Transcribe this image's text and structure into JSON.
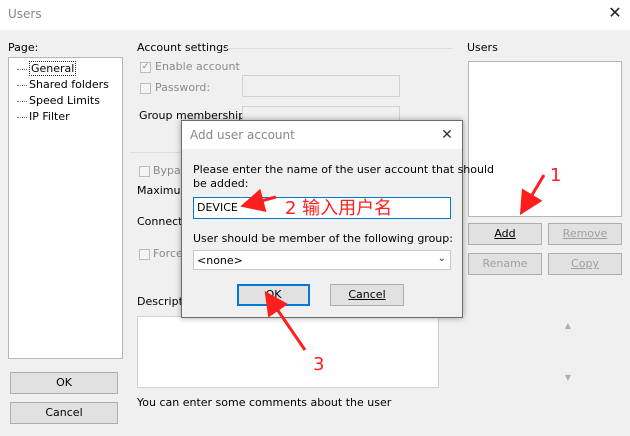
{
  "window": {
    "title": "Users",
    "close_glyph": "✕"
  },
  "page_panel": {
    "label": "Page:",
    "items": [
      {
        "label": "General",
        "selected": true
      },
      {
        "label": "Shared folders"
      },
      {
        "label": "Speed Limits"
      },
      {
        "label": "IP Filter"
      }
    ]
  },
  "account_settings": {
    "heading": "Account settings",
    "enable_account": "Enable account",
    "password": "Password:",
    "group_membership": "Group membership:"
  },
  "hidden_fields": {
    "bypass": "Bypas",
    "maximum": "Maximum",
    "connection": "Connectio",
    "force": "Force",
    "description": "Descriptio"
  },
  "description_hint": "You can enter some comments about the user",
  "users_panel": {
    "label": "Users",
    "add": "Add",
    "remove": "Remove",
    "rename": "Rename",
    "copy": "Copy"
  },
  "footer": {
    "ok": "OK",
    "cancel": "Cancel"
  },
  "dialog": {
    "title": "Add user account",
    "close_glyph": "✕",
    "prompt_line1": "Please enter the name of the user account that should",
    "prompt_line2": "be added:",
    "name_value": "DEVICE",
    "group_label": "User should be member of the following group:",
    "group_value": "<none>",
    "ok": "OK",
    "cancel": "Cancel"
  },
  "annotations": {
    "step1": "1",
    "step2": "2 输入用户名",
    "step3": "3",
    "color": "#ff1e1e"
  }
}
